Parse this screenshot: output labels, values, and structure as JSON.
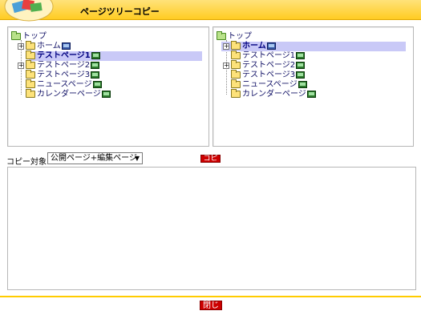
{
  "window": {
    "title": "ページツリーコピー"
  },
  "left_tree": {
    "root": "トップ",
    "items": [
      {
        "label": "ホーム",
        "expandable": true,
        "selected": false,
        "icon": "computer-icon-blue"
      },
      {
        "label": "テストページ1",
        "expandable": false,
        "selected": true,
        "icon": "computer-icon"
      },
      {
        "label": "テストページ2",
        "expandable": true,
        "selected": false,
        "icon": "computer-icon"
      },
      {
        "label": "テストページ3",
        "expandable": false,
        "selected": false,
        "icon": "computer-icon"
      },
      {
        "label": "ニュースページ",
        "expandable": false,
        "selected": false,
        "icon": "computer-icon"
      },
      {
        "label": "カレンダーページ",
        "expandable": false,
        "selected": false,
        "icon": "computer-icon"
      }
    ]
  },
  "right_tree": {
    "root": "トップ",
    "items": [
      {
        "label": "ホーム",
        "expandable": true,
        "selected": true,
        "icon": "computer-icon-blue"
      },
      {
        "label": "テストページ1",
        "expandable": false,
        "selected": false,
        "icon": "computer-icon"
      },
      {
        "label": "テストページ2",
        "expandable": true,
        "selected": false,
        "icon": "computer-icon"
      },
      {
        "label": "テストページ3",
        "expandable": false,
        "selected": false,
        "icon": "computer-icon"
      },
      {
        "label": "ニュースページ",
        "expandable": false,
        "selected": false,
        "icon": "computer-icon"
      },
      {
        "label": "カレンダーページ",
        "expandable": false,
        "selected": false,
        "icon": "computer-icon"
      }
    ]
  },
  "copy_options": {
    "label": "コピー対象:",
    "selected": "公開ページ+編集ページ"
  },
  "buttons": {
    "copy": "コピー",
    "close": "閉じる"
  },
  "colors": {
    "title_bar": "#ffcc22",
    "selection": "#c9c9f7",
    "button_red": "#cc0000"
  }
}
